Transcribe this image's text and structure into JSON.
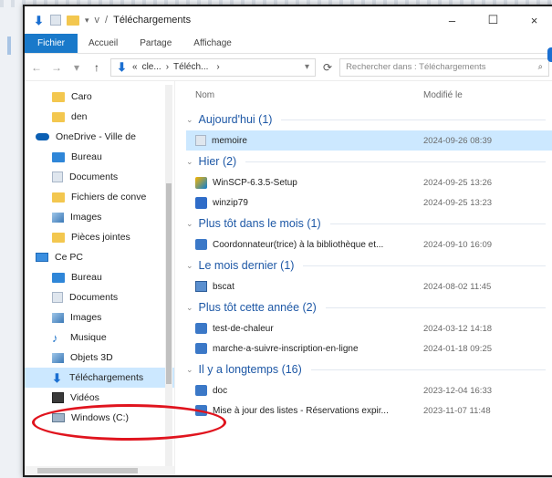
{
  "window": {
    "title": "Téléchargements",
    "path_prefix": "v",
    "controls": {
      "minimize": "–",
      "maximize": "☐",
      "close": "×"
    }
  },
  "ribbon": {
    "tabs": [
      "Fichier",
      "Accueil",
      "Partage",
      "Affichage"
    ]
  },
  "address": {
    "crumbs": [
      "cle...",
      "Téléch..."
    ],
    "refresh": "⟳",
    "search_placeholder": "Rechercher dans : Téléchargements"
  },
  "nav_pane": {
    "items": [
      {
        "label": "Caro",
        "icon": "folder-icon"
      },
      {
        "label": "den",
        "icon": "folder-icon"
      },
      {
        "label": "OneDrive - Ville de",
        "icon": "onedrive-cloud-icon"
      },
      {
        "label": "Bureau",
        "icon": "desktop-folder-icon"
      },
      {
        "label": "Documents",
        "icon": "documents-icon"
      },
      {
        "label": "Fichiers de conve",
        "icon": "folder-icon"
      },
      {
        "label": "Images",
        "icon": "images-icon"
      },
      {
        "label": "Pièces jointes",
        "icon": "folder-icon"
      },
      {
        "label": "Ce PC",
        "icon": "this-pc-icon"
      },
      {
        "label": "Bureau",
        "icon": "desktop-folder-icon"
      },
      {
        "label": "Documents",
        "icon": "documents-icon"
      },
      {
        "label": "Images",
        "icon": "images-icon"
      },
      {
        "label": "Musique",
        "icon": "music-icon"
      },
      {
        "label": "Objets 3D",
        "icon": "3d-objects-icon"
      },
      {
        "label": "Téléchargements",
        "icon": "downloads-icon",
        "selected": true
      },
      {
        "label": "Vidéos",
        "icon": "videos-icon"
      },
      {
        "label": "Windows (C:)",
        "icon": "drive-icon"
      }
    ]
  },
  "columns": {
    "name": "Nom",
    "modified": "Modifié le"
  },
  "groups": [
    {
      "label": "Aujourd'hui (1)",
      "files": [
        {
          "name": "memoire",
          "date": "2024-09-26 08:39",
          "icon": "file-icon",
          "selected": true
        }
      ]
    },
    {
      "label": "Hier (2)",
      "files": [
        {
          "name": "WinSCP-6.3.5-Setup",
          "date": "2024-09-25 13:26",
          "icon": "installer-icon"
        },
        {
          "name": "winzip79",
          "date": "2024-09-25 13:23",
          "icon": "zip-icon"
        }
      ]
    },
    {
      "label": "Plus tôt dans le mois (1)",
      "files": [
        {
          "name": "Coordonnateur(trice) à la bibliothèque et...",
          "date": "2024-09-10 16:09",
          "icon": "shortcut-icon"
        }
      ]
    },
    {
      "label": "Le mois dernier (1)",
      "files": [
        {
          "name": "bscat",
          "date": "2024-08-02 11:45",
          "icon": "binary-file-icon"
        }
      ]
    },
    {
      "label": "Plus tôt cette année (2)",
      "files": [
        {
          "name": "test-de-chaleur",
          "date": "2024-03-12 14:18",
          "icon": "shortcut-icon"
        },
        {
          "name": "marche-a-suivre-inscription-en-ligne",
          "date": "2024-01-18 09:25",
          "icon": "shortcut-icon"
        }
      ]
    },
    {
      "label": "Il y a longtemps (16)",
      "files": [
        {
          "name": "doc",
          "date": "2023-12-04 16:33",
          "icon": "shortcut-icon"
        },
        {
          "name": "Mise à jour des listes - Réservations expir...",
          "date": "2023-11-07 11:48",
          "icon": "shortcut-icon"
        }
      ]
    }
  ]
}
